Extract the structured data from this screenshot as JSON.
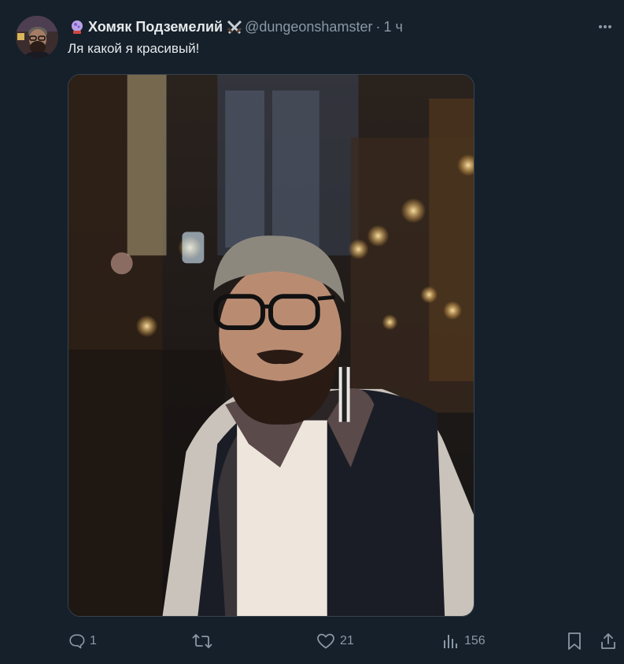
{
  "post": {
    "display_name": "Хомяк Подземелий",
    "handle": "@dungeonshamster",
    "separator": "·",
    "time": "1 ч",
    "text": "Ля какой я красивый!"
  },
  "icons": {
    "more": "more-icon",
    "reply": "reply-icon",
    "repost": "repost-icon",
    "like": "heart-icon",
    "views": "views-icon",
    "bookmark": "bookmark-icon",
    "share": "share-icon"
  },
  "stats": {
    "replies": "1",
    "reposts": "",
    "likes": "21",
    "views": "156"
  },
  "colors": {
    "background": "#15202b",
    "text": "#e7e9ea",
    "secondary": "#8b98a5",
    "border": "#38444d"
  }
}
